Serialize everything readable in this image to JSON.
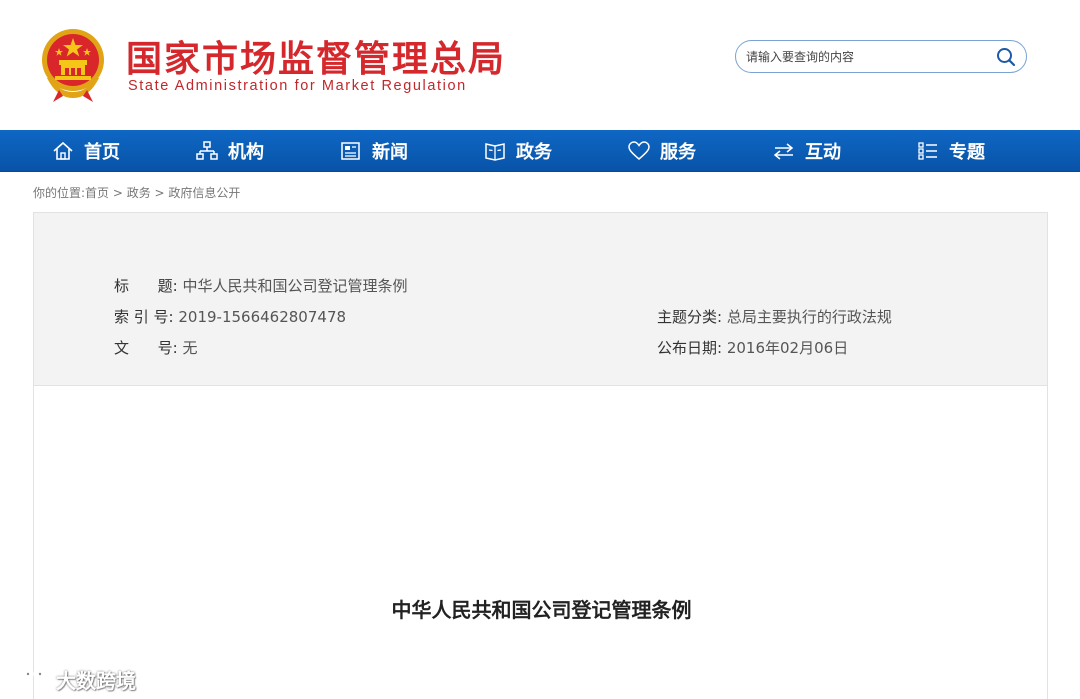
{
  "header": {
    "title_cn": "国家市场监督管理总局",
    "title_en": "State Administration for Market Regulation",
    "emblem_icon": "national-emblem-icon"
  },
  "search": {
    "placeholder": "请输入要查询的内容",
    "icon": "search-icon"
  },
  "nav": {
    "items": [
      {
        "label": "首页",
        "icon": "home-icon"
      },
      {
        "label": "机构",
        "icon": "org-chart-icon"
      },
      {
        "label": "新闻",
        "icon": "newspaper-icon"
      },
      {
        "label": "政务",
        "icon": "document-icon"
      },
      {
        "label": "服务",
        "icon": "heart-icon"
      },
      {
        "label": "互动",
        "icon": "exchange-icon"
      },
      {
        "label": "专题",
        "icon": "list-icon"
      }
    ]
  },
  "breadcrumb": "你的位置:首页 > 政务 > 政府信息公开",
  "info": {
    "title_label": "标      题:",
    "title_value": "中华人民共和国公司登记管理条例",
    "index_label": "索 引 号:",
    "index_value": "2019-1566462807478",
    "docno_label": "文      号:",
    "docno_value": "无",
    "category_label": "主题分类:",
    "category_value": "总局主要执行的行政法规",
    "date_label": "公布日期:",
    "date_value": "2016年02月06日"
  },
  "document": {
    "title": "中华人民共和国公司登记管理条例"
  },
  "watermark": {
    "text": "大数跨境"
  },
  "colors": {
    "brand_red": "#d4282c",
    "nav_blue": "#0a5cb8",
    "panel_gray": "#f3f3f3"
  }
}
